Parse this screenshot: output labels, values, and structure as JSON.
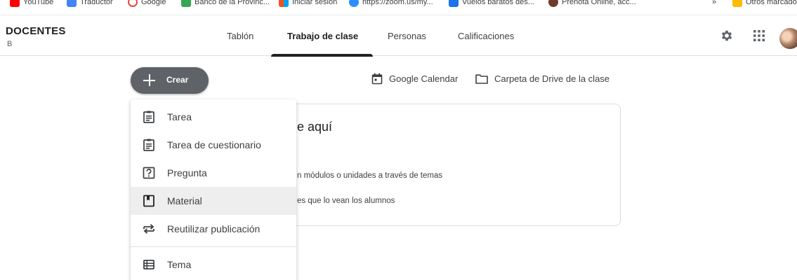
{
  "bookmarks": [
    {
      "label": "YouTube",
      "color": "#ff0000"
    },
    {
      "label": "Traductor",
      "color": "#4285f4"
    },
    {
      "label": "Google",
      "color": "#ea4335"
    },
    {
      "label": "Banco de la Provinc...",
      "color": "#34a853"
    },
    {
      "label": "Iniciar sesión",
      "color": "#f25022"
    },
    {
      "label": "https://zoom.us/my...",
      "color": "#2d8cff"
    },
    {
      "label": "Vuelos baratos des...",
      "color": "#1a73e8"
    },
    {
      "label": "Prenota Online, acc...",
      "color": "#6d3b2a"
    }
  ],
  "bookmarks_more": "»",
  "bookmarks_other": "Otros marcado",
  "header": {
    "class_name": "DOCENTES",
    "class_section": "B",
    "tabs": [
      {
        "label": "Tablón",
        "active": false
      },
      {
        "label": "Trabajo de clase",
        "active": true
      },
      {
        "label": "Personas",
        "active": false
      },
      {
        "label": "Calificaciones",
        "active": false
      }
    ]
  },
  "create_button": {
    "label": "Crear"
  },
  "links": {
    "calendar": "Google Calendar",
    "drive": "Carpeta de Drive de la clase"
  },
  "card": {
    "title": "e aquí",
    "line1": "n módulos o unidades a través de temas",
    "line2": "es que lo vean los alumnos"
  },
  "menu": {
    "items": [
      {
        "label": "Tarea",
        "icon": "assignment-icon"
      },
      {
        "label": "Tarea de cuestionario",
        "icon": "quiz-assignment-icon"
      },
      {
        "label": "Pregunta",
        "icon": "question-icon"
      },
      {
        "label": "Material",
        "icon": "material-icon"
      },
      {
        "label": "Reutilizar publicación",
        "icon": "reuse-post-icon"
      },
      {
        "label": "Tema",
        "icon": "topic-icon"
      }
    ]
  },
  "colors": {
    "create_button_bg": "#5f6368",
    "menu_hover": "#eeeeee",
    "active_tab": "#202124"
  }
}
